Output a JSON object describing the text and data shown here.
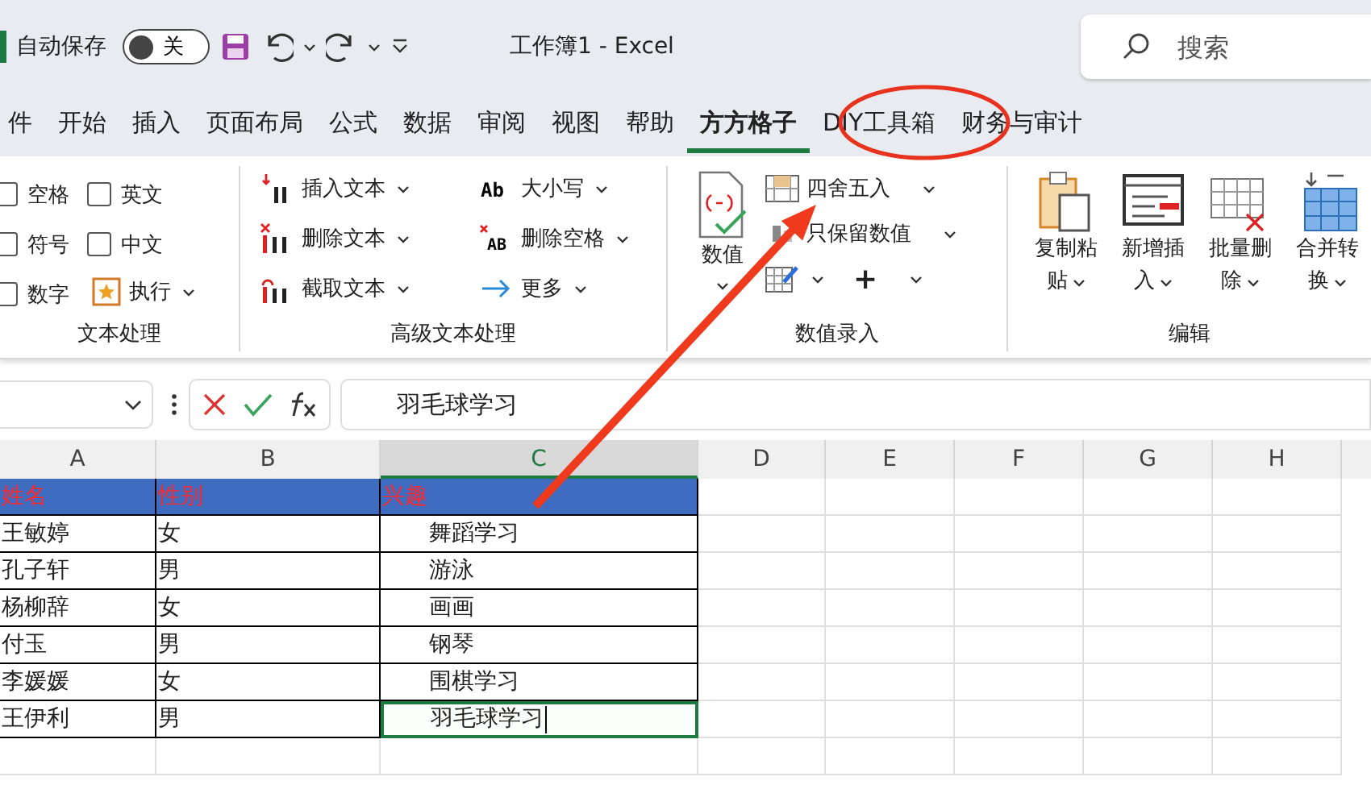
{
  "title_bar": {
    "autosave_label": "自动保存",
    "autosave_toggle": {
      "label": "关",
      "on": false
    },
    "title": "工作簿1  -  Excel",
    "search": {
      "placeholder": "搜索"
    }
  },
  "tabs": [
    {
      "label": "件",
      "selected": false
    },
    {
      "label": "开始",
      "selected": false
    },
    {
      "label": "插入",
      "selected": false
    },
    {
      "label": "页面布局",
      "selected": false
    },
    {
      "label": "公式",
      "selected": false
    },
    {
      "label": "数据",
      "selected": false
    },
    {
      "label": "审阅",
      "selected": false
    },
    {
      "label": "视图",
      "selected": false
    },
    {
      "label": "帮助",
      "selected": false
    },
    {
      "label": "方方格子",
      "selected": true
    },
    {
      "label": "DIY工具箱",
      "selected": false
    },
    {
      "label": "财务与审计",
      "selected": false
    }
  ],
  "ribbon": {
    "text_group": {
      "label": "文本处理",
      "checkboxes": [
        {
          "label": "空格",
          "checked": false
        },
        {
          "label": "英文",
          "checked": false
        },
        {
          "label": "符号",
          "checked": false
        },
        {
          "label": "中文",
          "checked": false
        },
        {
          "label": "数字",
          "checked": false
        }
      ],
      "run_button": "执行"
    },
    "advanced_group": {
      "label": "高级文本处理",
      "buttons": [
        {
          "label": "插入文本",
          "kind": "insert"
        },
        {
          "label": "删除文本",
          "kind": "delete"
        },
        {
          "label": "截取文本",
          "kind": "cut"
        },
        {
          "label": "大小写",
          "kind": "case",
          "icon_text": "Ab"
        },
        {
          "label": "删除空格",
          "kind": "space",
          "icon_text": "AB"
        },
        {
          "label": "更多",
          "kind": "more"
        }
      ]
    },
    "number_group": {
      "label": "数值录入",
      "big_button": "数值",
      "buttons": [
        {
          "label": "四舍五入",
          "kind": "round"
        },
        {
          "label": "只保留数值",
          "kind": "keep"
        }
      ],
      "plus": "+"
    },
    "edit_group": {
      "label": "编辑",
      "buttons": [
        {
          "label": "复制粘",
          "label2": "贴",
          "kind": "paste"
        },
        {
          "label": "新增插",
          "label2": "入",
          "kind": "insert"
        },
        {
          "label": "批量删",
          "label2": "除",
          "kind": "delete"
        },
        {
          "label": "合并转",
          "label2": "换",
          "kind": "merge"
        }
      ]
    }
  },
  "formula_bar": {
    "value": "羽毛球学习"
  },
  "sheet": {
    "columns": [
      {
        "label": "A",
        "selected": false
      },
      {
        "label": "B",
        "selected": false
      },
      {
        "label": "C",
        "selected": true
      },
      {
        "label": "D",
        "selected": false
      },
      {
        "label": "E",
        "selected": false
      },
      {
        "label": "F",
        "selected": false
      },
      {
        "label": "G",
        "selected": false
      },
      {
        "label": "H",
        "selected": false
      }
    ],
    "header_row": [
      "姓名",
      "性别",
      "兴趣"
    ],
    "rows": [
      {
        "cells": [
          "王敏婷",
          "女",
          "舞蹈学习"
        ],
        "selected": false
      },
      {
        "cells": [
          "孔子轩",
          "男",
          "游泳"
        ],
        "selected": false
      },
      {
        "cells": [
          "杨柳辞",
          "女",
          "画画"
        ],
        "selected": false
      },
      {
        "cells": [
          "付玉",
          "男",
          "钢琴"
        ],
        "selected": false
      },
      {
        "cells": [
          "李媛媛",
          "女",
          "围棋学习"
        ],
        "selected": false
      },
      {
        "cells": [
          "王伊利",
          "男",
          "羽毛球学习"
        ],
        "selected": true
      }
    ]
  }
}
